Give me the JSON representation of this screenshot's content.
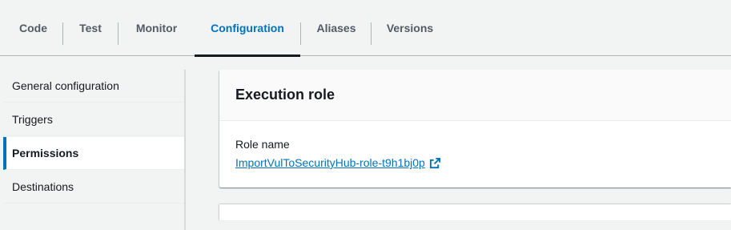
{
  "tabs": [
    {
      "label": "Code"
    },
    {
      "label": "Test"
    },
    {
      "label": "Monitor"
    },
    {
      "label": "Configuration"
    },
    {
      "label": "Aliases"
    },
    {
      "label": "Versions"
    }
  ],
  "active_tab": "Configuration",
  "sidenav": {
    "items": [
      {
        "label": "General configuration"
      },
      {
        "label": "Triggers"
      },
      {
        "label": "Permissions"
      },
      {
        "label": "Destinations"
      }
    ],
    "selected": "Permissions"
  },
  "execution_role": {
    "title": "Execution role",
    "role_name_label": "Role name",
    "role_name_link": "ImportVulToSecurityHub-role-t9h1bj0p"
  },
  "colors": {
    "accent": "#0073bb",
    "text": "#16191f",
    "background": "#f2f3f3"
  }
}
